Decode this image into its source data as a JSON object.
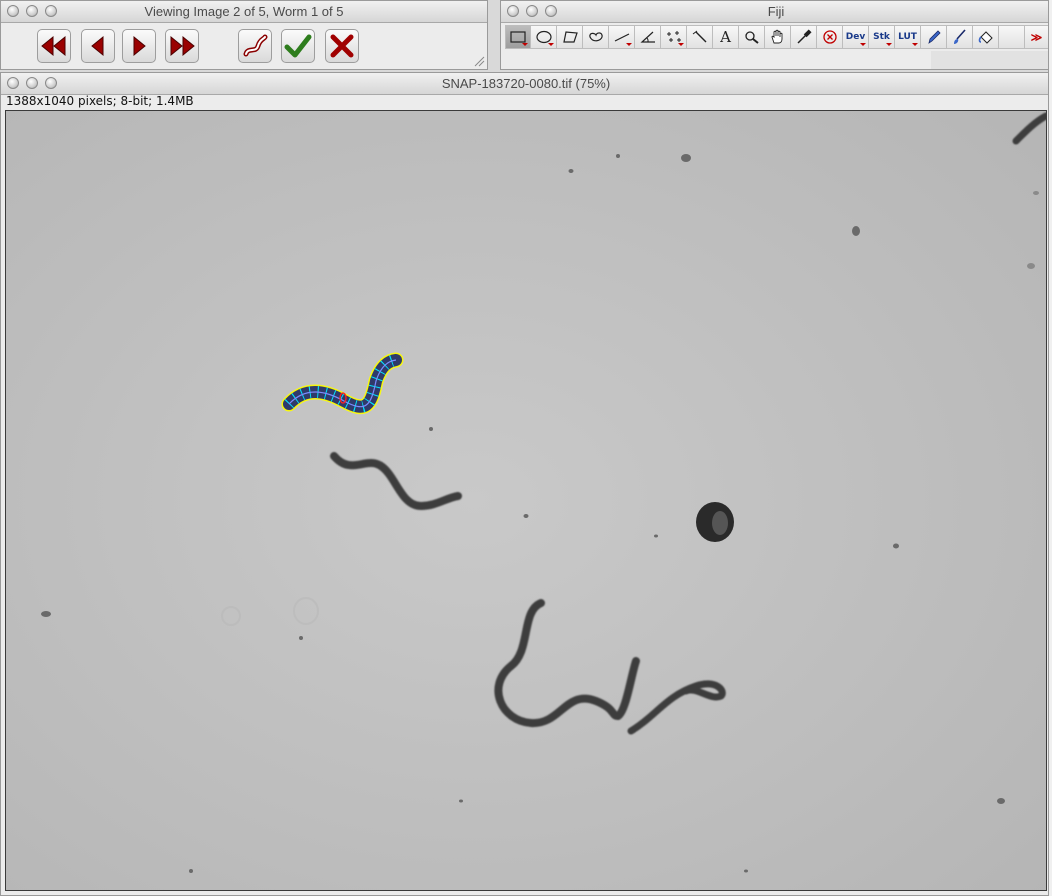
{
  "navigator": {
    "title": "Viewing Image 2 of 5, Worm 1 of 5",
    "buttons": [
      {
        "name": "first-image-button",
        "icon": "double-left-arrow-icon"
      },
      {
        "name": "prev-image-button",
        "icon": "left-arrow-icon"
      },
      {
        "name": "next-image-button",
        "icon": "right-arrow-icon"
      },
      {
        "name": "last-image-button",
        "icon": "double-right-arrow-icon"
      },
      {
        "name": "draw-worm-button",
        "icon": "worm-outline-icon"
      },
      {
        "name": "accept-button",
        "icon": "checkmark-icon"
      },
      {
        "name": "reject-button",
        "icon": "x-mark-icon"
      }
    ],
    "colors": {
      "arrow": "#9a0000",
      "check": "#2e7d1d",
      "x": "#a00000"
    }
  },
  "fiji": {
    "title": "Fiji",
    "tools": [
      {
        "name": "rectangle-tool",
        "icon": "rectangle-icon",
        "active": true
      },
      {
        "name": "oval-tool",
        "icon": "oval-icon"
      },
      {
        "name": "polygon-tool",
        "icon": "polygon-icon"
      },
      {
        "name": "freehand-tool",
        "icon": "freehand-icon"
      },
      {
        "name": "line-tool",
        "icon": "line-icon"
      },
      {
        "name": "angle-tool",
        "icon": "angle-icon"
      },
      {
        "name": "point-tool",
        "icon": "point-icon"
      },
      {
        "name": "wand-tool",
        "icon": "wand-icon"
      },
      {
        "name": "text-tool",
        "icon": "text-icon",
        "label": "A"
      },
      {
        "name": "zoom-tool",
        "icon": "magnifier-icon"
      },
      {
        "name": "hand-tool",
        "icon": "hand-icon"
      },
      {
        "name": "color-picker-tool",
        "icon": "dropper-icon"
      },
      {
        "name": "close-image-tool",
        "icon": "circle-x-icon"
      },
      {
        "name": "dev-menu-tool",
        "icon": "dev-icon",
        "label": "Dev"
      },
      {
        "name": "stack-menu-tool",
        "icon": "stack-icon",
        "label": "Stk"
      },
      {
        "name": "lut-menu-tool",
        "icon": "lut-icon",
        "label": "LUT"
      },
      {
        "name": "pencil-tool",
        "icon": "pencil-icon"
      },
      {
        "name": "brush-tool",
        "icon": "brush-icon"
      },
      {
        "name": "flood-fill-tool",
        "icon": "bucket-icon"
      },
      {
        "name": "empty-tool",
        "icon": "blank-icon"
      },
      {
        "name": "more-tools",
        "icon": "double-chevron-icon",
        "label": "≫"
      }
    ]
  },
  "image": {
    "title": "SNAP-183720-0080.tif (75%)",
    "info": "1388x1040 pixels; 8-bit; 1.4MB",
    "zoom": "75%",
    "background_color": "#c2c2c2",
    "selection_color": "#ffff00",
    "spine_color": "#00e5ff"
  }
}
